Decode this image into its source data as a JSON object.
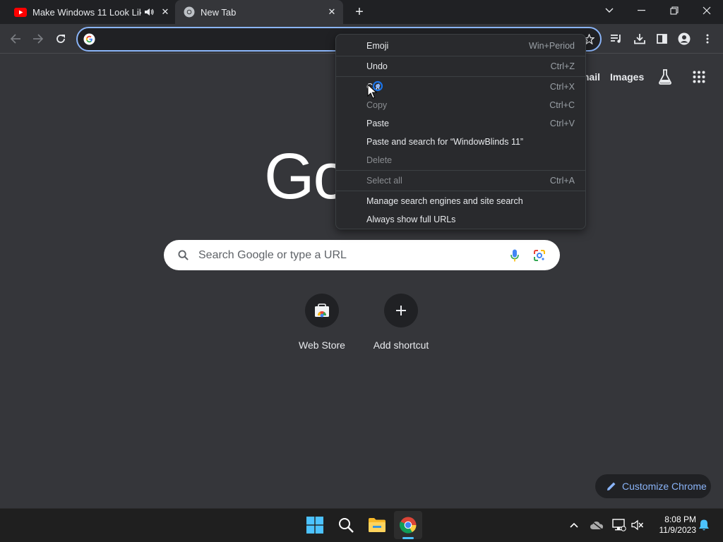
{
  "tabs": [
    {
      "title": "Make Windows 11 Look Lik",
      "favicon": "youtube-icon",
      "audio": "speaker-icon"
    },
    {
      "title": "New Tab",
      "favicon": "chrome-icon"
    }
  ],
  "omnibox": {
    "value": ""
  },
  "ntp": {
    "links": {
      "gmail": "Gmail",
      "images": "Images"
    },
    "logo": "Go",
    "search_placeholder": "Search Google or type a URL",
    "shortcuts": [
      {
        "label": "Web Store"
      },
      {
        "label": "Add shortcut"
      }
    ],
    "customize_label": "Customize Chrome"
  },
  "context_menu": {
    "items": [
      {
        "label": "Emoji",
        "shortcut": "Win+Period",
        "enabled": true
      },
      {
        "label": "Undo",
        "shortcut": "Ctrl+Z",
        "enabled": true
      },
      {
        "label": "Cut",
        "shortcut": "Ctrl+X",
        "enabled": true
      },
      {
        "label": "Copy",
        "shortcut": "Ctrl+C",
        "enabled": false
      },
      {
        "label": "Paste",
        "shortcut": "Ctrl+V",
        "enabled": true
      },
      {
        "label": "Paste and search for “WindowBlinds 11”",
        "shortcut": "",
        "enabled": true
      },
      {
        "label": "Delete",
        "shortcut": "",
        "enabled": false
      },
      {
        "label": "Select all",
        "shortcut": "Ctrl+A",
        "enabled": false
      },
      {
        "label": "Manage search engines and site search",
        "shortcut": "",
        "enabled": true
      },
      {
        "label": "Always show full URLs",
        "shortcut": "",
        "enabled": true
      }
    ]
  },
  "taskbar": {
    "clock_time": "8:08 PM",
    "clock_date": "11/9/2023"
  },
  "colors": {
    "accent": "#8ab4f8",
    "background": "#35363a",
    "frame": "#202124"
  }
}
